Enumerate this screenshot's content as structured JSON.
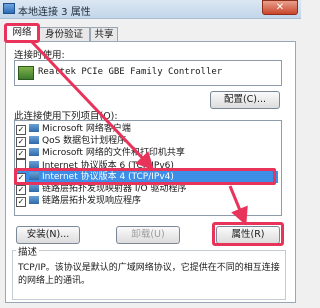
{
  "window": {
    "title": "本地连接 3 属性",
    "close_glyph": "✕"
  },
  "tabs": [
    {
      "label": "网络",
      "active": true
    },
    {
      "label": "身份验证",
      "active": false
    },
    {
      "label": "共享",
      "active": false
    }
  ],
  "connect_using": {
    "label": "连接时使用:",
    "adapter": "Realtek PCIe GBE Family Controller",
    "configure_button": "配置(C)..."
  },
  "items_section": {
    "label": "此连接使用下列项目(O):",
    "items": [
      {
        "label": "Microsoft 网络客户端",
        "checked": true,
        "selected": false
      },
      {
        "label": "QoS 数据包计划程序",
        "checked": true,
        "selected": false
      },
      {
        "label": "Microsoft 网络的文件和打印机共享",
        "checked": true,
        "selected": false
      },
      {
        "label": "Internet 协议版本 6 (TCP/IPv6)",
        "checked": false,
        "selected": false
      },
      {
        "label": "Internet 协议版本 4 (TCP/IPv4)",
        "checked": true,
        "selected": true
      },
      {
        "label": "链路层拓扑发现映射器 I/O 驱动程序",
        "checked": true,
        "selected": false
      },
      {
        "label": "链路层拓扑发现响应程序",
        "checked": true,
        "selected": false
      }
    ]
  },
  "buttons": {
    "install": "安装(N)...",
    "uninstall": "卸载(U)",
    "properties": "属性(R)"
  },
  "description": {
    "legend": "描述",
    "text": "TCP/IP。该协议是默认的广域网络协议，它提供在不同的相互连接的网络上的通讯。"
  },
  "colors": {
    "highlight": "#e8345a",
    "selection": "#3d8ee6"
  }
}
